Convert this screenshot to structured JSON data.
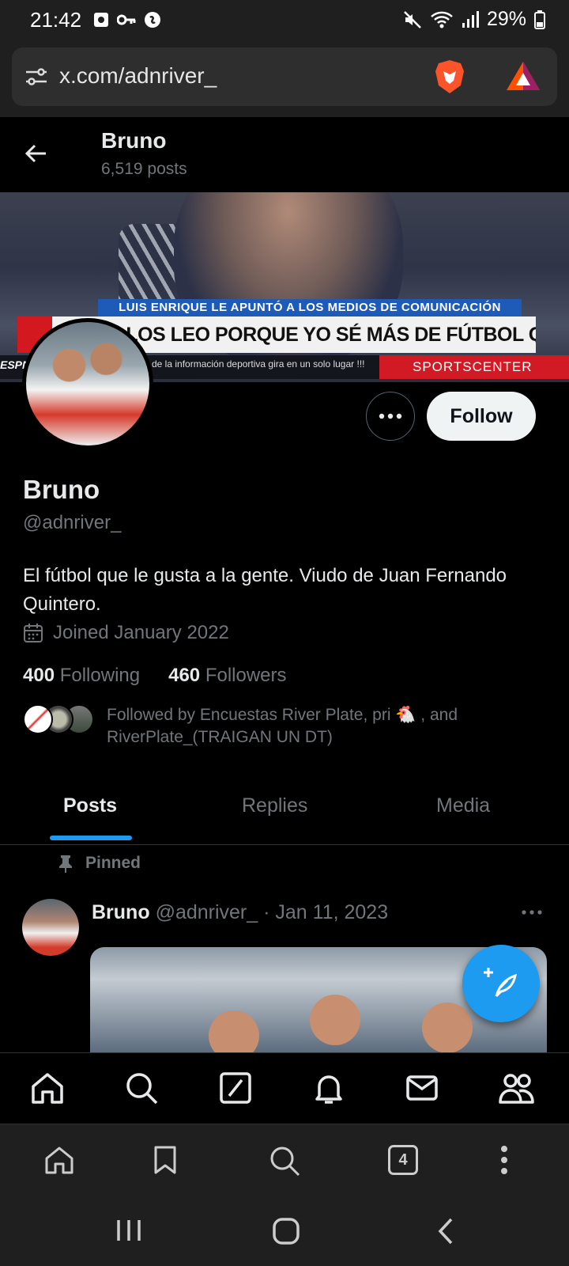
{
  "status": {
    "time": "21:42",
    "battery": "29%"
  },
  "browser": {
    "url": "x.com/adnriver_",
    "tabs_count": "4"
  },
  "profile_header": {
    "name": "Bruno",
    "posts_count": "6,519 posts"
  },
  "banner": {
    "top_caption": "LUIS ENRIQUE LE APUNTÓ A LOS MEDIOS DE COMUNICACIÓN",
    "main_caption": "...LOS LEO PORQUE YO SÉ MÁS DE FÚTBOL QUE LA MAYORÍA\"",
    "tagline": "de la información deportiva gira en un solo lugar !!!",
    "brand": "SPORTSCENTER",
    "network": "ESPN"
  },
  "actions": {
    "follow_label": "Follow"
  },
  "profile": {
    "name": "Bruno",
    "handle": "@adnriver_",
    "bio": "El fútbol que le gusta a la gente. Viudo de Juan Fernando Quintero.",
    "joined": "Joined January 2022",
    "following_count": "400",
    "following_label": "Following",
    "followers_count": "460",
    "followers_label": "Followers",
    "followed_by": "Followed by Encuestas River Plate, pri 🐔 , and RiverPlate_(TRAIGAN UN DT)"
  },
  "tabs": [
    {
      "label": "Posts",
      "active": true
    },
    {
      "label": "Replies",
      "active": false
    },
    {
      "label": "Media",
      "active": false
    }
  ],
  "post": {
    "pinned_label": "Pinned",
    "author": "Bruno",
    "handle": "@adnriver_",
    "date": "· Jan 11, 2023"
  },
  "colors": {
    "accent": "#1d9bf0",
    "background": "#000000",
    "muted": "#71767b"
  }
}
